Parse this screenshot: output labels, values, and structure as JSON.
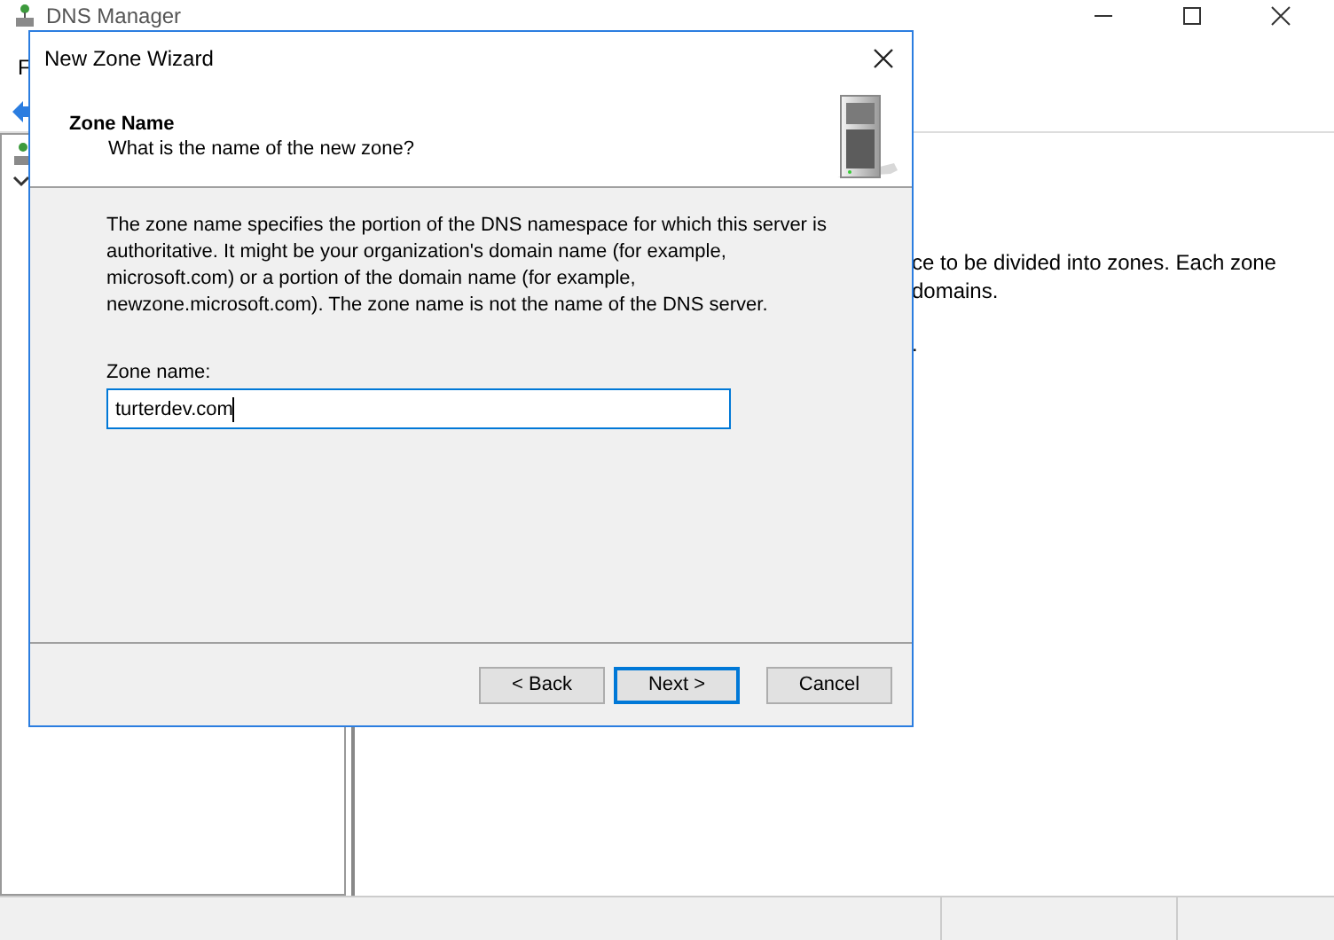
{
  "background_window": {
    "title": "DNS Manager",
    "menu": [
      "F"
    ],
    "right_panel_lines": [
      "ce to be divided into zones. Each zone",
      "domains.",
      "."
    ]
  },
  "dialog": {
    "title": "New Zone Wizard",
    "heading": "Zone Name",
    "subheading": "What is the name of the new zone?",
    "description": "The zone name specifies the portion of the DNS namespace for which this server is authoritative. It might be your organization's domain name (for example,  microsoft.com) or a portion of the domain name (for example, newzone.microsoft.com). The zone name is not the name of the DNS server.",
    "field": {
      "label": "Zone name:",
      "value": "turterdev.com",
      "focused": true
    },
    "buttons": [
      {
        "label": "< Back",
        "default": false
      },
      {
        "label": "Next >",
        "default": true
      },
      {
        "label": "Cancel",
        "default": false
      }
    ]
  }
}
